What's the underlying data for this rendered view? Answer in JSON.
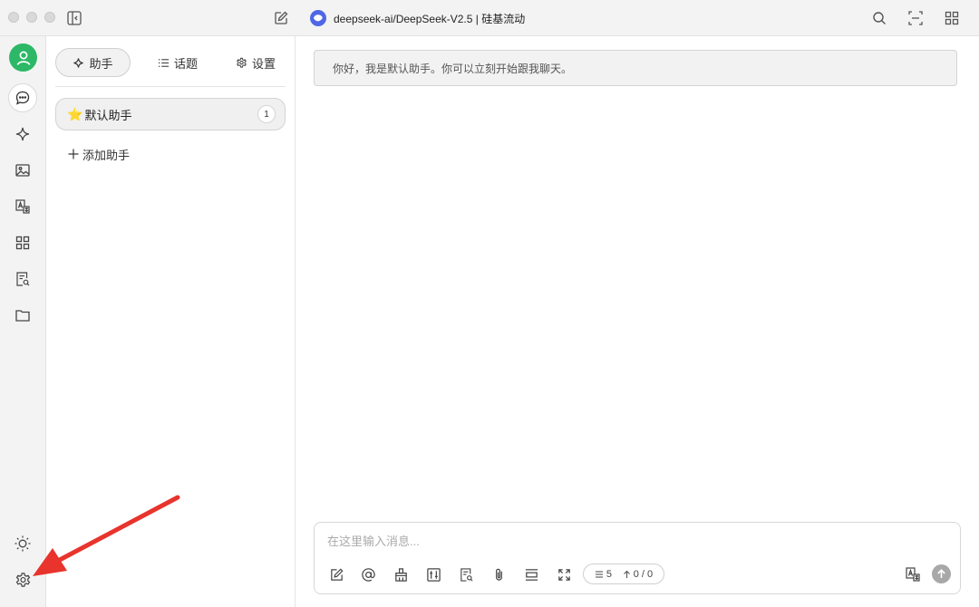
{
  "window": {
    "model_title": "deepseek-ai/DeepSeek-V2.5 | 硅基流动"
  },
  "rail": {
    "items": [
      "user-avatar",
      "chat-icon",
      "sparkle-icon",
      "image-icon",
      "translate-icon",
      "apps-grid-icon",
      "document-search-icon",
      "folder-icon",
      "theme-sun-icon",
      "settings-gear-icon"
    ]
  },
  "panel": {
    "tabs": [
      {
        "label": "助手",
        "icon": "sparkle-icon"
      },
      {
        "label": "话题",
        "icon": "list-icon"
      },
      {
        "label": "设置",
        "icon": "gear-icon"
      }
    ],
    "assistant": {
      "emoji": "⭐️",
      "name": "默认助手",
      "count": "1"
    },
    "add_label": "添加助手"
  },
  "main": {
    "welcome": "你好，我是默认助手。你可以立刻开始跟我聊天。",
    "composer": {
      "placeholder": "在这里输入消息...",
      "context_count": "5",
      "tokens": "0 / 0"
    }
  },
  "annotation": {
    "color": "#e8342c",
    "target": "settings-gear-icon"
  }
}
